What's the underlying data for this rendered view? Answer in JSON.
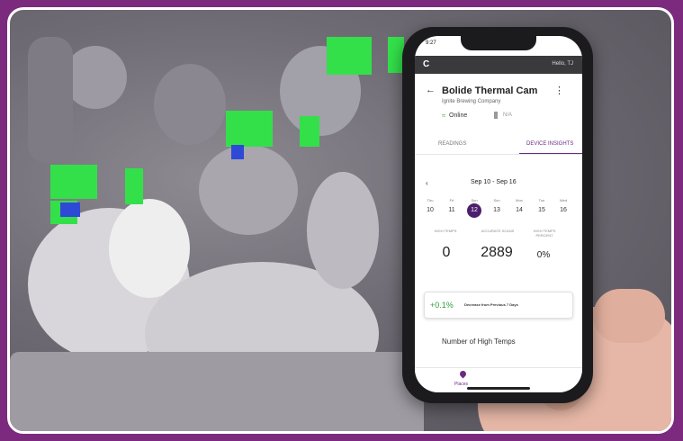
{
  "phone": {
    "status_time": "9:27",
    "app_logo": "C",
    "user_label": "Hello, TJ",
    "device_title": "Bolide Thermal Cam",
    "company": "Ignite Brewing Company",
    "online": "Online",
    "na": "N/A",
    "tabs": [
      "READINGS",
      "DEVICE INSIGHTS"
    ],
    "date_range": "Sep 10 - Sep 16",
    "weekdays": [
      "Thu",
      "Fri",
      "Sun",
      "Sun",
      "Mon",
      "Tue",
      "Wed"
    ],
    "days": [
      "10",
      "11",
      "12",
      "13",
      "14",
      "15",
      "16"
    ],
    "selected_day": "12",
    "metrics": [
      {
        "label": "HIGH TEMPS",
        "value": "0"
      },
      {
        "label": "ACCURATE SCANS",
        "value": "2889"
      },
      {
        "label": "HIGH TEMPS PERCENT",
        "value": "0%"
      }
    ],
    "change_pct": "+0.1%",
    "change_text": "Decrease from Previous 7 Days",
    "section_title": "Number of High Temps",
    "nav_label": "Places"
  },
  "colors": {
    "background": "#7b2a7e",
    "accent": "#6b2a86",
    "hot": "#33e04a",
    "cool": "#2e49d6"
  }
}
